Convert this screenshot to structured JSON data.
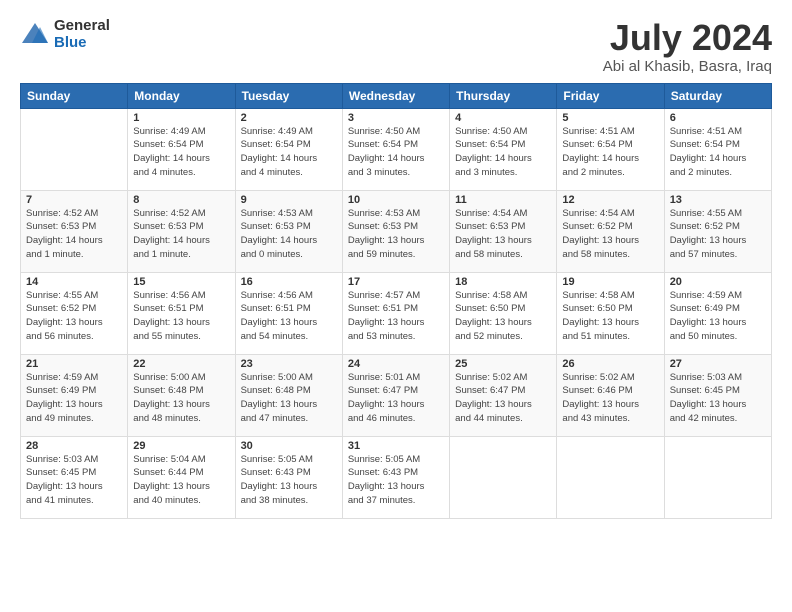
{
  "header": {
    "logo_general": "General",
    "logo_blue": "Blue",
    "title": "July 2024",
    "location": "Abi al Khasib, Basra, Iraq"
  },
  "weekdays": [
    "Sunday",
    "Monday",
    "Tuesday",
    "Wednesday",
    "Thursday",
    "Friday",
    "Saturday"
  ],
  "weeks": [
    [
      {
        "day": "",
        "info": ""
      },
      {
        "day": "1",
        "info": "Sunrise: 4:49 AM\nSunset: 6:54 PM\nDaylight: 14 hours\nand 4 minutes."
      },
      {
        "day": "2",
        "info": "Sunrise: 4:49 AM\nSunset: 6:54 PM\nDaylight: 14 hours\nand 4 minutes."
      },
      {
        "day": "3",
        "info": "Sunrise: 4:50 AM\nSunset: 6:54 PM\nDaylight: 14 hours\nand 3 minutes."
      },
      {
        "day": "4",
        "info": "Sunrise: 4:50 AM\nSunset: 6:54 PM\nDaylight: 14 hours\nand 3 minutes."
      },
      {
        "day": "5",
        "info": "Sunrise: 4:51 AM\nSunset: 6:54 PM\nDaylight: 14 hours\nand 2 minutes."
      },
      {
        "day": "6",
        "info": "Sunrise: 4:51 AM\nSunset: 6:54 PM\nDaylight: 14 hours\nand 2 minutes."
      }
    ],
    [
      {
        "day": "7",
        "info": "Sunrise: 4:52 AM\nSunset: 6:53 PM\nDaylight: 14 hours\nand 1 minute."
      },
      {
        "day": "8",
        "info": "Sunrise: 4:52 AM\nSunset: 6:53 PM\nDaylight: 14 hours\nand 1 minute."
      },
      {
        "day": "9",
        "info": "Sunrise: 4:53 AM\nSunset: 6:53 PM\nDaylight: 14 hours\nand 0 minutes."
      },
      {
        "day": "10",
        "info": "Sunrise: 4:53 AM\nSunset: 6:53 PM\nDaylight: 13 hours\nand 59 minutes."
      },
      {
        "day": "11",
        "info": "Sunrise: 4:54 AM\nSunset: 6:53 PM\nDaylight: 13 hours\nand 58 minutes."
      },
      {
        "day": "12",
        "info": "Sunrise: 4:54 AM\nSunset: 6:52 PM\nDaylight: 13 hours\nand 58 minutes."
      },
      {
        "day": "13",
        "info": "Sunrise: 4:55 AM\nSunset: 6:52 PM\nDaylight: 13 hours\nand 57 minutes."
      }
    ],
    [
      {
        "day": "14",
        "info": "Sunrise: 4:55 AM\nSunset: 6:52 PM\nDaylight: 13 hours\nand 56 minutes."
      },
      {
        "day": "15",
        "info": "Sunrise: 4:56 AM\nSunset: 6:51 PM\nDaylight: 13 hours\nand 55 minutes."
      },
      {
        "day": "16",
        "info": "Sunrise: 4:56 AM\nSunset: 6:51 PM\nDaylight: 13 hours\nand 54 minutes."
      },
      {
        "day": "17",
        "info": "Sunrise: 4:57 AM\nSunset: 6:51 PM\nDaylight: 13 hours\nand 53 minutes."
      },
      {
        "day": "18",
        "info": "Sunrise: 4:58 AM\nSunset: 6:50 PM\nDaylight: 13 hours\nand 52 minutes."
      },
      {
        "day": "19",
        "info": "Sunrise: 4:58 AM\nSunset: 6:50 PM\nDaylight: 13 hours\nand 51 minutes."
      },
      {
        "day": "20",
        "info": "Sunrise: 4:59 AM\nSunset: 6:49 PM\nDaylight: 13 hours\nand 50 minutes."
      }
    ],
    [
      {
        "day": "21",
        "info": "Sunrise: 4:59 AM\nSunset: 6:49 PM\nDaylight: 13 hours\nand 49 minutes."
      },
      {
        "day": "22",
        "info": "Sunrise: 5:00 AM\nSunset: 6:48 PM\nDaylight: 13 hours\nand 48 minutes."
      },
      {
        "day": "23",
        "info": "Sunrise: 5:00 AM\nSunset: 6:48 PM\nDaylight: 13 hours\nand 47 minutes."
      },
      {
        "day": "24",
        "info": "Sunrise: 5:01 AM\nSunset: 6:47 PM\nDaylight: 13 hours\nand 46 minutes."
      },
      {
        "day": "25",
        "info": "Sunrise: 5:02 AM\nSunset: 6:47 PM\nDaylight: 13 hours\nand 44 minutes."
      },
      {
        "day": "26",
        "info": "Sunrise: 5:02 AM\nSunset: 6:46 PM\nDaylight: 13 hours\nand 43 minutes."
      },
      {
        "day": "27",
        "info": "Sunrise: 5:03 AM\nSunset: 6:45 PM\nDaylight: 13 hours\nand 42 minutes."
      }
    ],
    [
      {
        "day": "28",
        "info": "Sunrise: 5:03 AM\nSunset: 6:45 PM\nDaylight: 13 hours\nand 41 minutes."
      },
      {
        "day": "29",
        "info": "Sunrise: 5:04 AM\nSunset: 6:44 PM\nDaylight: 13 hours\nand 40 minutes."
      },
      {
        "day": "30",
        "info": "Sunrise: 5:05 AM\nSunset: 6:43 PM\nDaylight: 13 hours\nand 38 minutes."
      },
      {
        "day": "31",
        "info": "Sunrise: 5:05 AM\nSunset: 6:43 PM\nDaylight: 13 hours\nand 37 minutes."
      },
      {
        "day": "",
        "info": ""
      },
      {
        "day": "",
        "info": ""
      },
      {
        "day": "",
        "info": ""
      }
    ]
  ]
}
